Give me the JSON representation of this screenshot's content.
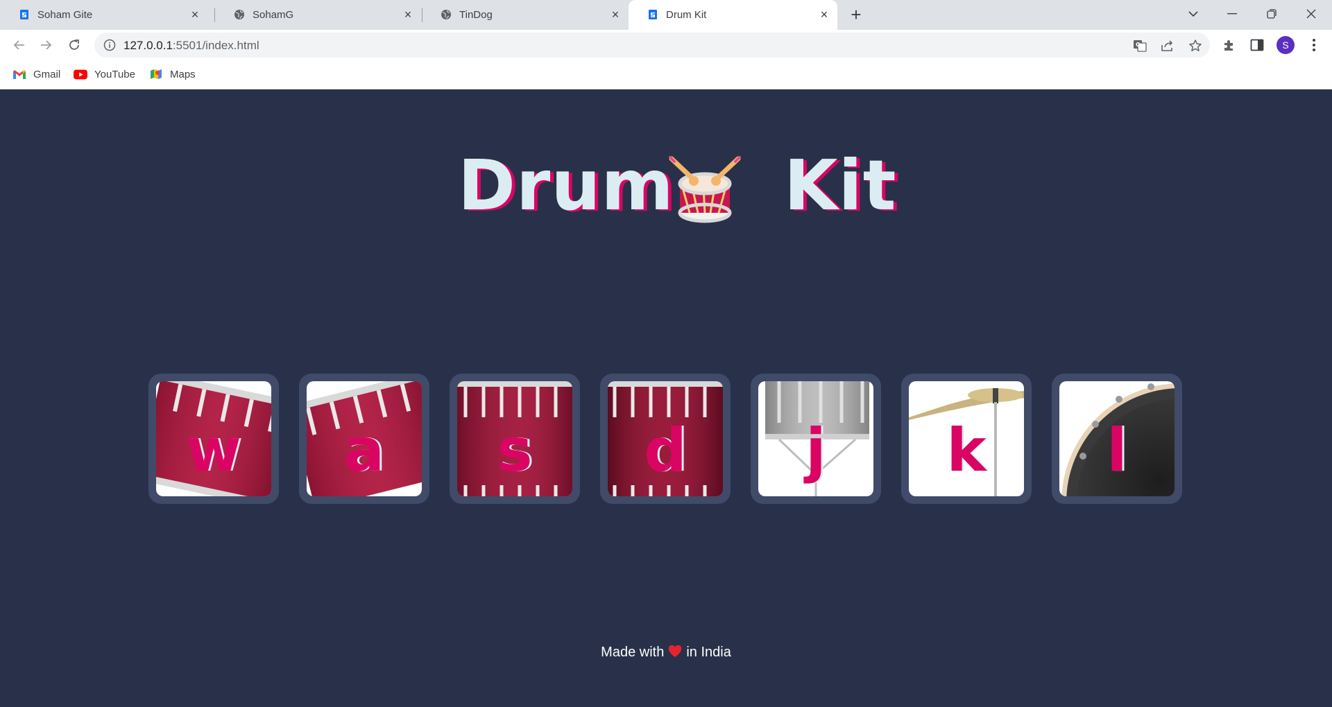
{
  "browser": {
    "tabs": [
      {
        "label": "Soham Gite",
        "icon": "document-icon",
        "active": false
      },
      {
        "label": "SohamG",
        "icon": "globe-icon",
        "active": false
      },
      {
        "label": "TinDog",
        "icon": "globe-icon",
        "active": false
      },
      {
        "label": "Drum Kit",
        "icon": "document-icon",
        "active": true
      }
    ],
    "url_host": "127.0.0.1",
    "url_path": ":5501/index.html",
    "profile_initial": "S",
    "bookmarks": [
      {
        "label": "Gmail",
        "icon": "gmail-icon"
      },
      {
        "label": "YouTube",
        "icon": "youtube-icon"
      },
      {
        "label": "Maps",
        "icon": "maps-icon"
      }
    ]
  },
  "page": {
    "title_left": "Drum",
    "title_right": "Kit",
    "drums": [
      {
        "key": "w",
        "instrument": "tom-1"
      },
      {
        "key": "a",
        "instrument": "tom-2"
      },
      {
        "key": "s",
        "instrument": "tom-3"
      },
      {
        "key": "d",
        "instrument": "tom-4"
      },
      {
        "key": "j",
        "instrument": "snare"
      },
      {
        "key": "k",
        "instrument": "crash"
      },
      {
        "key": "l",
        "instrument": "kick"
      }
    ],
    "footer_before": "Made with",
    "footer_after": "in India"
  },
  "colors": {
    "background": "#283149",
    "button_frame": "#404b69",
    "accent": "#da0463",
    "title_text": "#dbedf3"
  }
}
